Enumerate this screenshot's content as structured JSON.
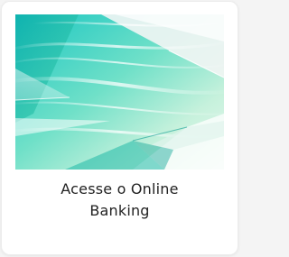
{
  "card": {
    "title_line1": "Acesse o Online",
    "title_line2": "Banking",
    "image_icon": "abstract-teal-glass-image"
  },
  "colors": {
    "card_background": "#ffffff",
    "page_background": "#f4f4f4",
    "text": "#222222",
    "teal": "#22c7b8",
    "mint": "#a8ecd0"
  }
}
